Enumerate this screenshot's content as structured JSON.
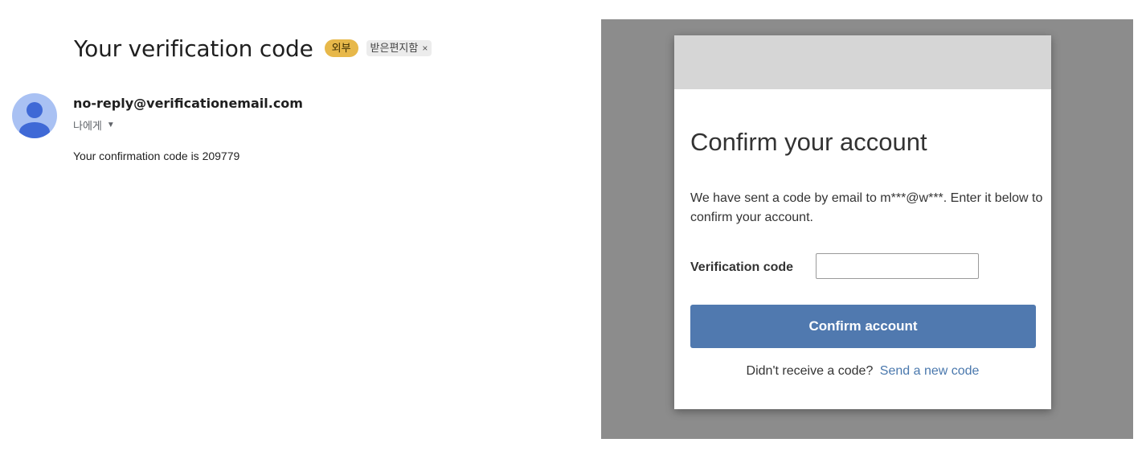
{
  "email": {
    "subject": "Your verification code",
    "external_badge": "외부",
    "label_chip": "받은편지함",
    "label_chip_close": "×",
    "sender": "no-reply@verificationemail.com",
    "recipient": "나에게",
    "body": "Your confirmation code is 209779"
  },
  "dialog": {
    "title": "Confirm your account",
    "description": "We have sent a code by email to m***@w***. Enter it below to confirm your account.",
    "code_label": "Verification code",
    "code_value": "",
    "confirm_button": "Confirm account",
    "resend_prompt": "Didn't receive a code?",
    "resend_link": "Send a new code"
  },
  "colors": {
    "badge": "#e7b84a",
    "avatar": "#a9c1f3",
    "button": "#5079af",
    "link": "#4a78ad",
    "overlay": "#8c8c8c"
  },
  "icons": {
    "avatar": "person-icon",
    "recipient_dropdown": "chevron-down-icon",
    "chip_remove": "close-icon"
  }
}
